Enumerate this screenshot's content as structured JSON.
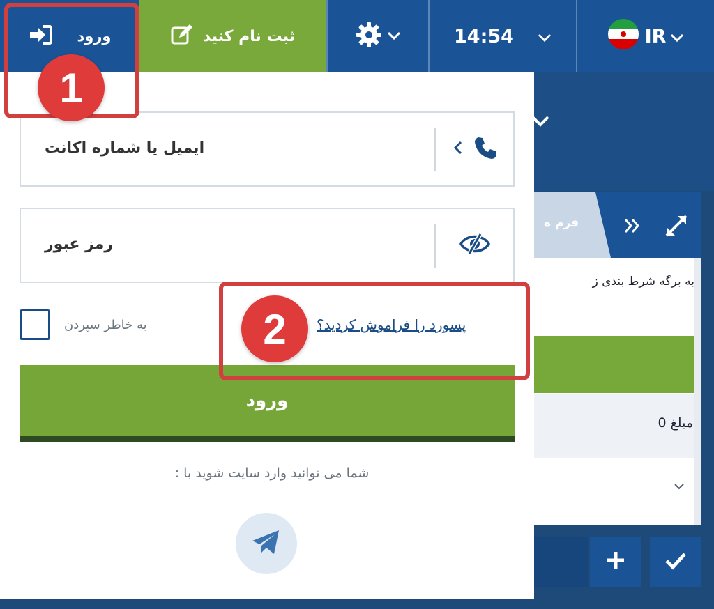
{
  "topbar": {
    "login_label": "ورود",
    "register_label": "ثبت نام کنید",
    "time": "14:54",
    "language": "IR"
  },
  "login_form": {
    "email_placeholder": "ایمیل یا شماره اکانت",
    "password_placeholder": "رمز عبور",
    "remember_label": "به خاطر سپردن",
    "forgot_link": "پسورد را فراموش کردید؟",
    "submit_label": "ورود",
    "social_text": ": شما می توانید وارد سایت شوید با"
  },
  "background_panel": {
    "tab_label": "فرم ه",
    "row1_text": "به برگه شرط بندی ز",
    "row2_text": "مبلغ 0"
  },
  "annotations": {
    "marker_1": "1",
    "marker_2": "2",
    "highlight_color": "#d23f3f"
  },
  "colors": {
    "primary_blue": "#1a5496",
    "green": "#76a637"
  }
}
